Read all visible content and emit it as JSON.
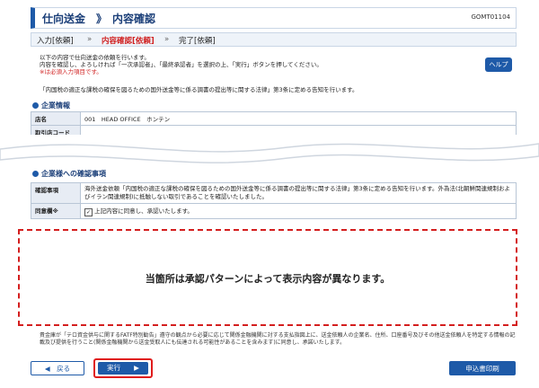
{
  "header": {
    "title": "仕向送金　》　内容確認",
    "screen_code": "GOMT01104"
  },
  "steps": [
    {
      "label": "入力[依頼]",
      "active": false
    },
    {
      "label": "»",
      "active": false
    },
    {
      "label": "内容確認[依頼]",
      "active": true
    },
    {
      "label": "»",
      "active": false
    },
    {
      "label": "完了[依頼]",
      "active": false
    }
  ],
  "instructions": [
    "以下の内容で仕向送金の依頼を行います。",
    "内容を確認し、よろしければ「一次承認者」、「最終承認者」を選択の上、「実行」ボタンを押してください。",
    "※は必須入力項目です。",
    "「内国税の適正な課税の確保を図るための国外送金等に係る調書の提出等に関する法律」第3条に定める告知を行います。"
  ],
  "help_label": "ヘルプ",
  "company": {
    "section_title": "企業情報",
    "rows": [
      {
        "label": "店名",
        "value": "001　HEAD OFFICE　ホンテン"
      },
      {
        "label": "取引店コード",
        "value": ""
      }
    ]
  },
  "confirm": {
    "section_title": "企業様への確認事項",
    "rows": [
      {
        "label": "確認事項",
        "value": "海外送金依頼「内国税の適正な課税の確保を図るための国外送金等に係る調書の提出等に関する法律」第3条に定める告知を行います。外為法(北朝鮮関連規制およびイラン関連規制)に抵触しない取引であることを確認いたしました。"
      },
      {
        "label": "同意欄※",
        "value": "上記内容に同意し、承認いたします。"
      }
    ]
  },
  "dashed_message": "当箇所は承認パターンによって表示内容が異なります。",
  "footer_note": "貴金庫が「テロ資金供与に関するFATF特別勧告」遵守の観点から必要に応じて関係金融機関に対する支払指図上に、送金依頼人の企業名、住所、口座番号及びその他送金依頼人を特定する情報の記載及び提供を行うこと(関係金融機関から送金受取人にも伝達される可能性があることを含みます)に同意し、承諾いたします。",
  "buttons": {
    "back": "◀　戻る",
    "execute": "実行　　▶",
    "print": "申込書印刷"
  }
}
